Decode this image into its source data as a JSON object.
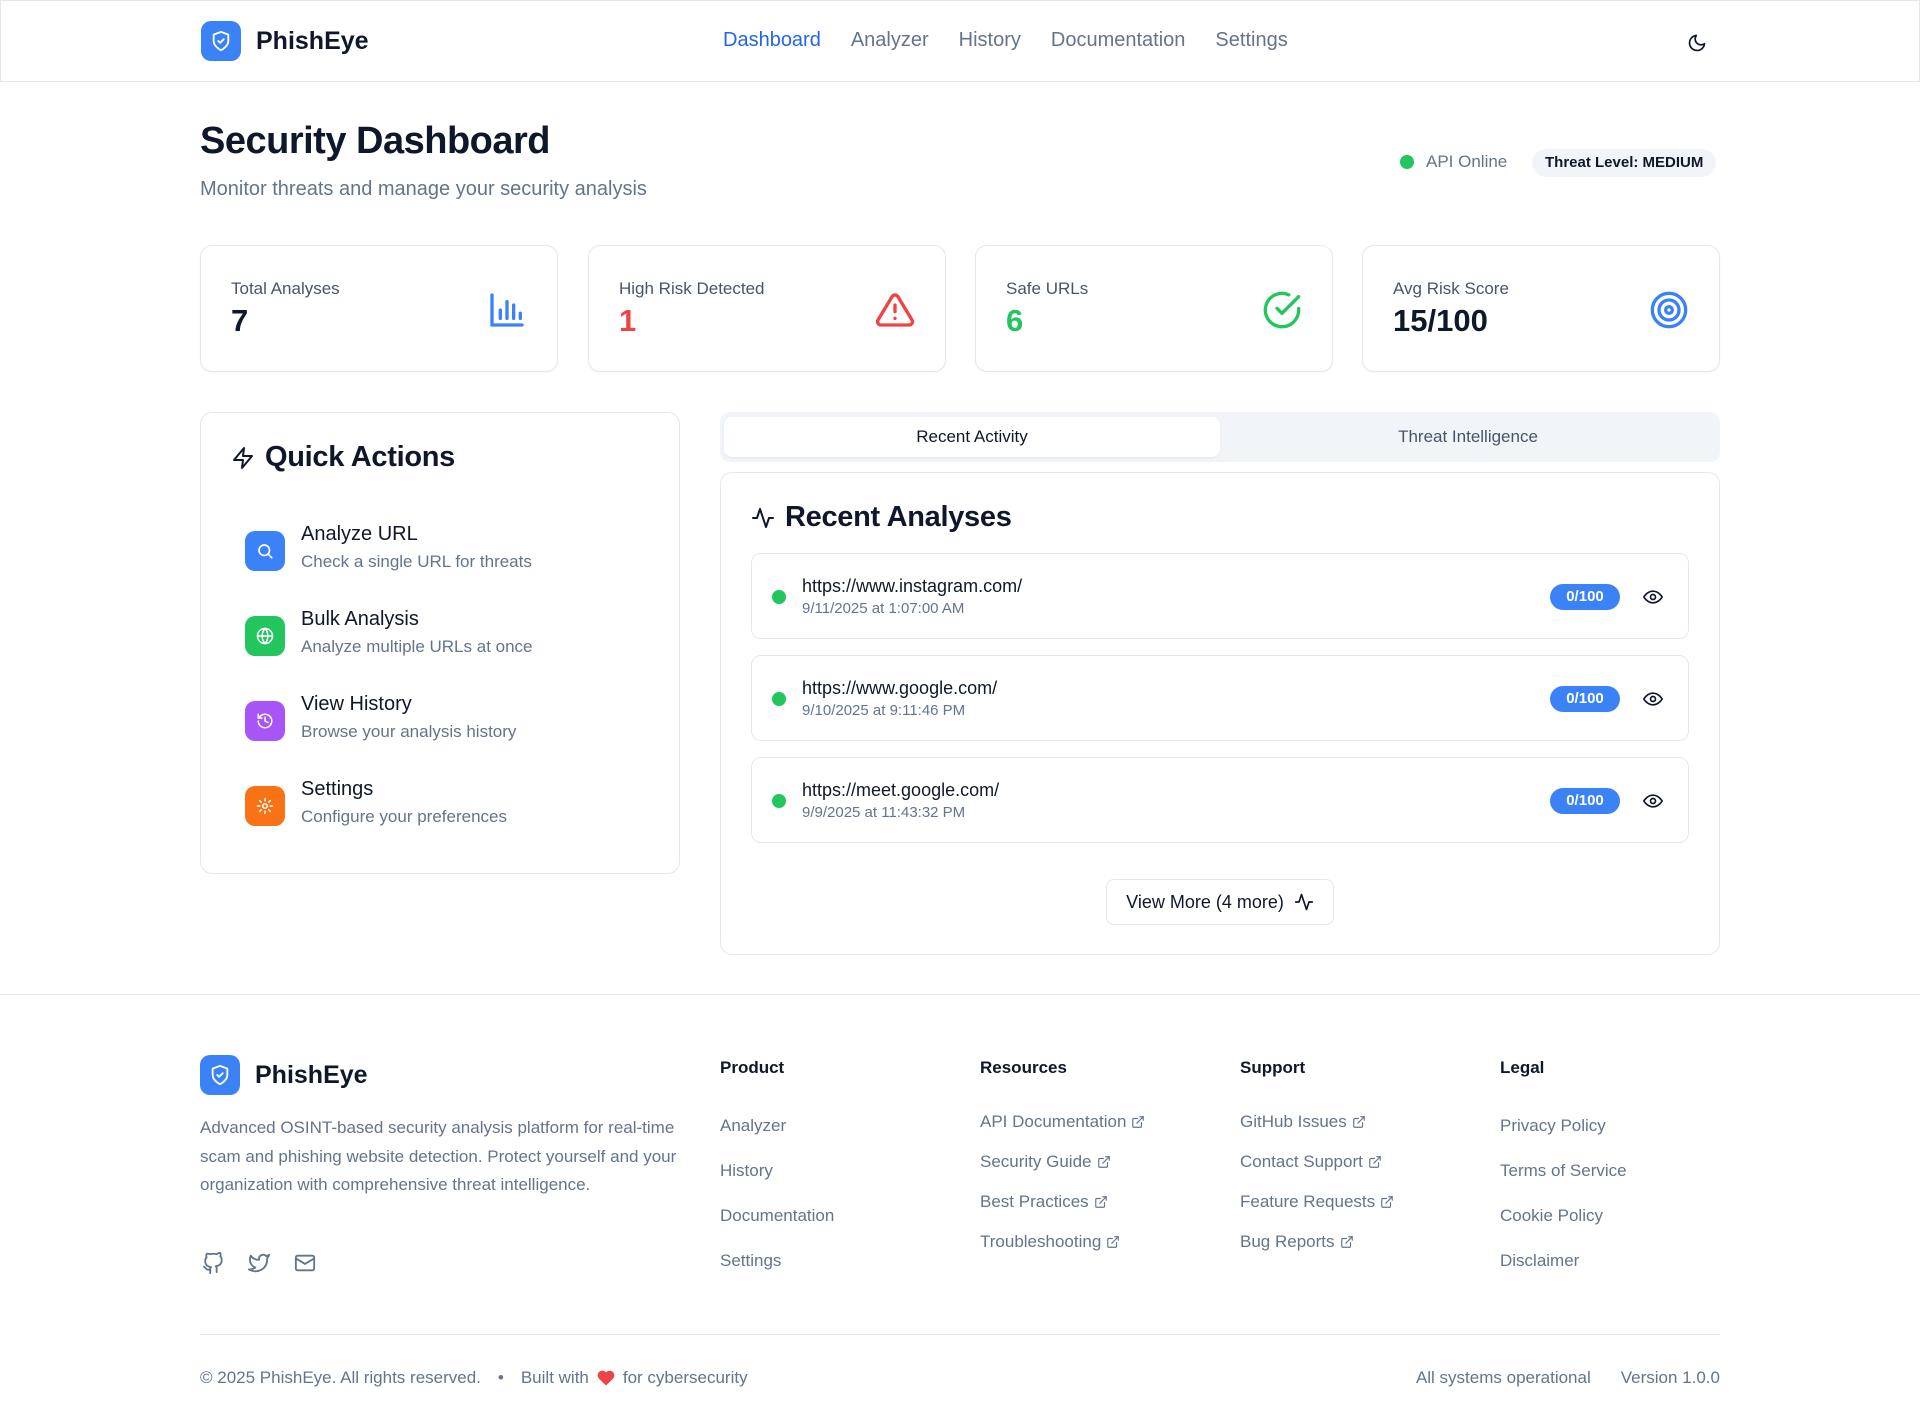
{
  "brand": {
    "name": "PhishEye"
  },
  "nav": {
    "items": [
      {
        "label": "Dashboard",
        "active": true
      },
      {
        "label": "Analyzer",
        "active": false
      },
      {
        "label": "History",
        "active": false
      },
      {
        "label": "Documentation",
        "active": false
      },
      {
        "label": "Settings",
        "active": false
      }
    ],
    "theme_toggle_icon": "moon-icon"
  },
  "header": {
    "title": "Security Dashboard",
    "subtitle": "Monitor threats and manage your security analysis",
    "api_status": "API Online",
    "threat_level": "Threat Level: MEDIUM"
  },
  "stats": [
    {
      "label": "Total Analyses",
      "value": "7",
      "color": "#0f172a",
      "icon": "bar-chart-icon"
    },
    {
      "label": "High Risk Detected",
      "value": "1",
      "color": "#ef4444",
      "icon": "warning-triangle-icon"
    },
    {
      "label": "Safe URLs",
      "value": "6",
      "color": "#22c55e",
      "icon": "check-circle-icon"
    },
    {
      "label": "Avg Risk Score",
      "value": "15/100",
      "color": "#0f172a",
      "icon": "target-icon"
    }
  ],
  "quick_actions": {
    "title": "Quick Actions",
    "items": [
      {
        "name": "Analyze URL",
        "desc": "Check a single URL for threats",
        "color": "#3b82f6",
        "icon": "search-icon"
      },
      {
        "name": "Bulk Analysis",
        "desc": "Analyze multiple URLs at once",
        "color": "#22c55e",
        "icon": "globe-icon"
      },
      {
        "name": "View History",
        "desc": "Browse your analysis history",
        "color": "#a855f7",
        "icon": "history-icon"
      },
      {
        "name": "Settings",
        "desc": "Configure your preferences",
        "color": "#f97316",
        "icon": "gear-icon"
      }
    ]
  },
  "tabs": [
    {
      "label": "Recent Activity",
      "active": true
    },
    {
      "label": "Threat Intelligence",
      "active": false
    }
  ],
  "recent": {
    "title": "Recent Analyses",
    "items": [
      {
        "url": "https://www.instagram.com/",
        "time": "9/11/2025 at 1:07:00 AM",
        "score": "0/100"
      },
      {
        "url": "https://www.google.com/",
        "time": "9/10/2025 at 9:11:46 PM",
        "score": "0/100"
      },
      {
        "url": "https://meet.google.com/",
        "time": "9/9/2025 at 11:43:32 PM",
        "score": "0/100"
      }
    ],
    "view_more": "View More (4 more)"
  },
  "footer": {
    "description": "Advanced OSINT-based security analysis platform for real-time scam and phishing website detection. Protect yourself and your organization with comprehensive threat intelligence.",
    "socials": [
      "github-icon",
      "twitter-icon",
      "mail-icon"
    ],
    "columns": [
      {
        "title": "Product",
        "external": false,
        "links": [
          "Analyzer",
          "History",
          "Documentation",
          "Settings"
        ]
      },
      {
        "title": "Resources",
        "external": true,
        "links": [
          "API Documentation",
          "Security Guide",
          "Best Practices",
          "Troubleshooting"
        ]
      },
      {
        "title": "Support",
        "external": true,
        "links": [
          "GitHub Issues",
          "Contact Support",
          "Feature Requests",
          "Bug Reports"
        ]
      },
      {
        "title": "Legal",
        "external": false,
        "links": [
          "Privacy Policy",
          "Terms of Service",
          "Cookie Policy",
          "Disclaimer"
        ]
      }
    ],
    "copyright": "© 2025 PhishEye. All rights reserved.",
    "built_prefix": "Built with",
    "built_suffix": "for cybersecurity",
    "system_status": "All systems operational",
    "version": "Version 1.0.0"
  },
  "colors": {
    "accent": "#3b82f6",
    "online": "#22c55e",
    "danger": "#ef4444"
  }
}
